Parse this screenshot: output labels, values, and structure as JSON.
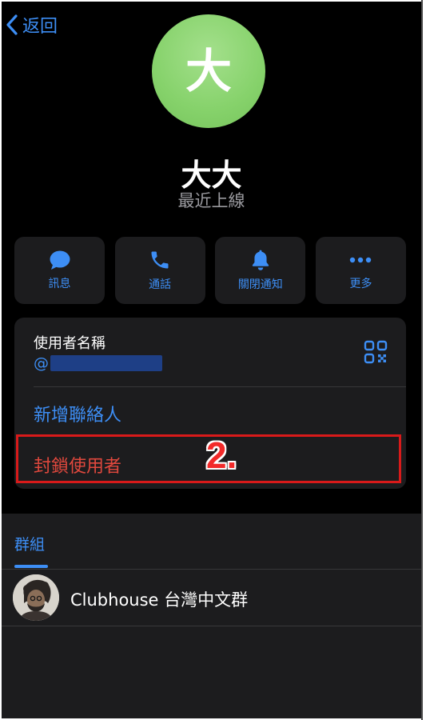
{
  "header": {
    "back_label": "返回"
  },
  "profile": {
    "avatar_initial": "大",
    "name": "大大",
    "status": "最近上線"
  },
  "actions": [
    {
      "icon": "message-bubble-icon",
      "label": "訊息"
    },
    {
      "icon": "phone-icon",
      "label": "通話"
    },
    {
      "icon": "bell-icon",
      "label": "關閉通知"
    },
    {
      "icon": "more-dots-icon",
      "label": "更多"
    }
  ],
  "info": {
    "username_label": "使用者名稱",
    "username_prefix": "@",
    "add_contact": "新增聯絡人",
    "block_user": "封鎖使用者"
  },
  "annotation": {
    "step_label": "2."
  },
  "groups": {
    "tab_label": "群組",
    "items": [
      {
        "name": "Clubhouse 台灣中文群"
      }
    ]
  },
  "colors": {
    "accent": "#3d8ef5",
    "danger": "#e0483d",
    "avatar_green": "#86d26b",
    "highlight_red": "#d91a1a"
  }
}
